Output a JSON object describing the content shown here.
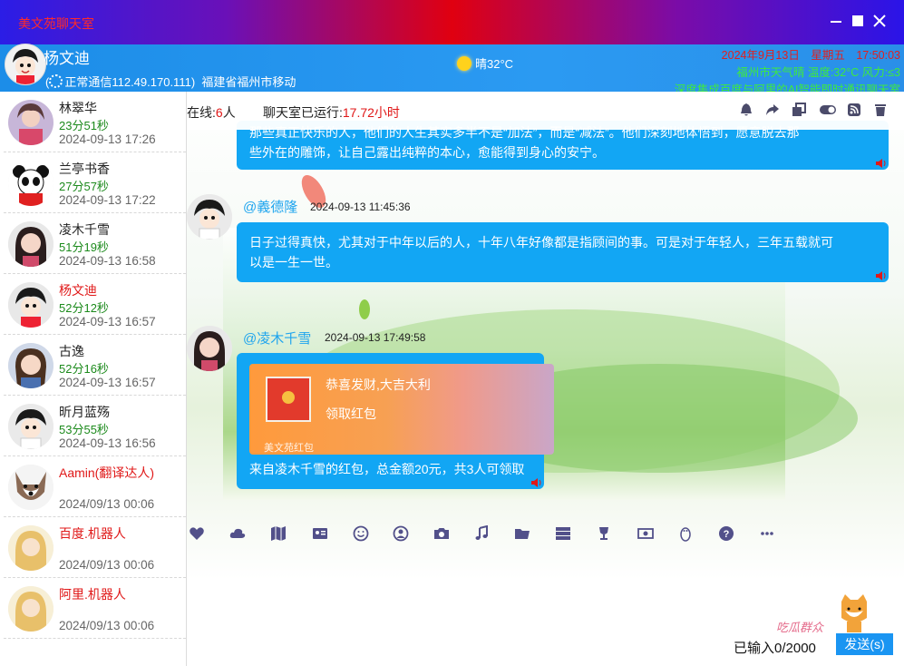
{
  "window": {
    "title": "美文苑聊天室",
    "min_icon": "minimize-icon",
    "max_icon": "maximize-icon",
    "close_icon": "close-icon"
  },
  "header": {
    "username": "杨文迪",
    "status_text": "正常通信112.49.170.111)",
    "status_prefix": "(",
    "location": "福建省福州市移动",
    "center_weather": "晴32°C",
    "datetime": "2024年9月13日　星期五　17:50:03",
    "city_weather": "福州市天气晴 温度:32°C 风力:≤3",
    "slogan": "深度集成百度与阿里的AI智能即时通讯聊天室"
  },
  "sidebar": {
    "contacts": [
      {
        "name": "林翠华",
        "duration": "23分51秒",
        "time": "2024-09-13 17:26",
        "highlight": false
      },
      {
        "name": "兰亭书香",
        "duration": "27分57秒",
        "time": "2024-09-13 17:22",
        "highlight": false
      },
      {
        "name": "凌木千雪",
        "duration": "51分19秒",
        "time": "2024-09-13 16:58",
        "highlight": false
      },
      {
        "name": "杨文迪",
        "duration": "52分12秒",
        "time": "2024-09-13 16:57",
        "highlight": true
      },
      {
        "name": "古逸",
        "duration": "52分16秒",
        "time": "2024-09-13 16:57",
        "highlight": false
      },
      {
        "name": "昕月蓝殇",
        "duration": "53分55秒",
        "time": "2024-09-13 16:56",
        "highlight": false
      },
      {
        "name": "Aamin(翻译达人)",
        "duration": "",
        "time": "2024/09/13 00:06",
        "highlight": true
      },
      {
        "name": "百度.机器人",
        "duration": "",
        "time": "2024/09/13 00:06",
        "highlight": true
      },
      {
        "name": "阿里.机器人",
        "duration": "",
        "time": "2024/09/13 00:06",
        "highlight": true
      }
    ]
  },
  "topbar": {
    "online_label": "在线:",
    "online_count": "6",
    "online_unit": "人",
    "uptime_label": "聊天室已运行:",
    "uptime_value": "17.72小时",
    "tools": [
      "bell-icon",
      "share-icon",
      "clone-icon",
      "toggle-icon",
      "rss-icon",
      "trash-icon"
    ]
  },
  "messages": [
    {
      "user": "",
      "time": "",
      "text_line1": "那些真正快乐的人，他们的人生其实多半不是“加法”，而是“减法”。他们深刻地体悟到，愿意脱去那",
      "text_line2": "些外在的雕饰，让自己露出纯粹的本心，愈能得到身心的安宁。"
    },
    {
      "user": "@義德隆",
      "time": "2024-09-13 11:45:36",
      "text_line1": "日子过得真快，尤其对于中年以后的人，十年八年好像都是指顾间的事。可是对于年轻人，三年五载就可",
      "text_line2": "以是一生一世。"
    },
    {
      "user": "@凌木千雪",
      "time": "2024-09-13 17:49:58",
      "red_packet": {
        "line1": "恭喜发财,大吉大利",
        "line2": "领取红包",
        "brand": "美文苑红包"
      },
      "text_line1": "来自凌木千雪的红包，总金额20元，共3人可领取"
    }
  ],
  "bottom_tools": [
    "heart-icon",
    "cloud-icon",
    "map-icon",
    "id-card-icon",
    "smile-icon",
    "user-circle-icon",
    "camera-icon",
    "music-icon",
    "folder-icon",
    "server-icon",
    "trophy-icon",
    "money-icon",
    "penguin-icon",
    "help-icon",
    "more-icon"
  ],
  "input": {
    "counter": "已输入0/2000",
    "send_label": "发送(s)",
    "mascot_text": "吃瓜群众"
  },
  "colors": {
    "bubble": "#12a6f4",
    "header": "#2b9af2",
    "red": "#e01818",
    "green": "#1c8a1c"
  }
}
